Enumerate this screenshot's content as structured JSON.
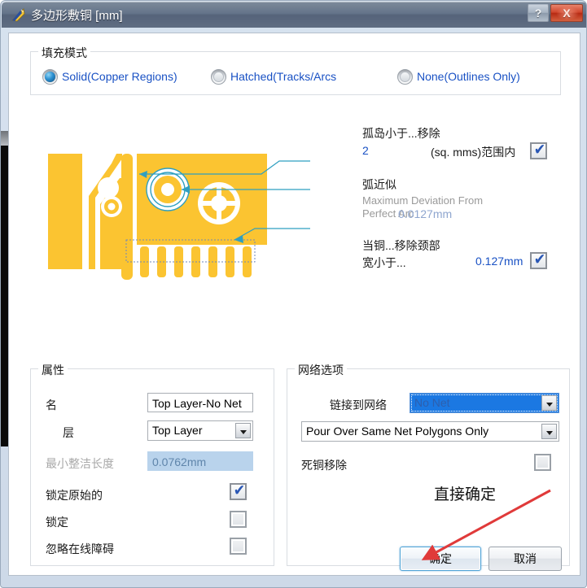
{
  "window": {
    "title": "多边形敷铜 [mm]",
    "icon": "polygon-pour-icon",
    "help_label": "?",
    "close_label": "X"
  },
  "fill_mode": {
    "group_title": "填充模式",
    "options": [
      {
        "label": "Solid(Copper Regions)",
        "selected": true
      },
      {
        "label": "Hatched(Tracks/Arcs",
        "selected": false
      },
      {
        "label": "None(Outlines Only)",
        "selected": false
      }
    ]
  },
  "settings": {
    "remove_islands": {
      "title": "孤岛小于...移除",
      "value": "2",
      "unit": "(sq. mms)范围内",
      "checked": true,
      "check_glyph": "✔"
    },
    "arc_approximation": {
      "title": "弧近似",
      "sub_line1": "Maximum Deviation From",
      "sub_line2": "Perfect Arc",
      "value": "0.0127mm"
    },
    "remove_necks": {
      "title": "当铜...移除颈部",
      "label": "宽小于...",
      "value": "0.127mm",
      "checked": true,
      "check_glyph": "✔"
    }
  },
  "properties": {
    "group_title": "属性",
    "name_label": "名",
    "name_value": "Top Layer-No Net",
    "layer_label": "层",
    "layer_value": "Top Layer",
    "min_prim_label": "最小整洁长度",
    "min_prim_value": "0.0762mm",
    "lock_primitives_label": "锁定原始的",
    "lock_primitives_checked": true,
    "locked_label": "锁定",
    "locked_checked": false,
    "ignore_violations_label": "忽略在线障碍",
    "ignore_violations_checked": false,
    "check_glyph": "✔"
  },
  "net_options": {
    "group_title": "网络选项",
    "connect_label": "链接到网络",
    "connect_value": "No Net",
    "pour_value": "Pour Over Same Net Polygons Only",
    "remove_dead_copper_label": "死铜移除",
    "remove_dead_copper_checked": false
  },
  "annotation": {
    "text": "直接确定",
    "color": "#e03a3a"
  },
  "buttons": {
    "ok": "确定",
    "cancel": "取消"
  },
  "colors": {
    "link_blue": "#1951c4",
    "copper": "#fbc431",
    "titlebar": "#5f6d82",
    "readonly_bg": "#b9d3ec",
    "select_blue": "#1b78e2"
  }
}
